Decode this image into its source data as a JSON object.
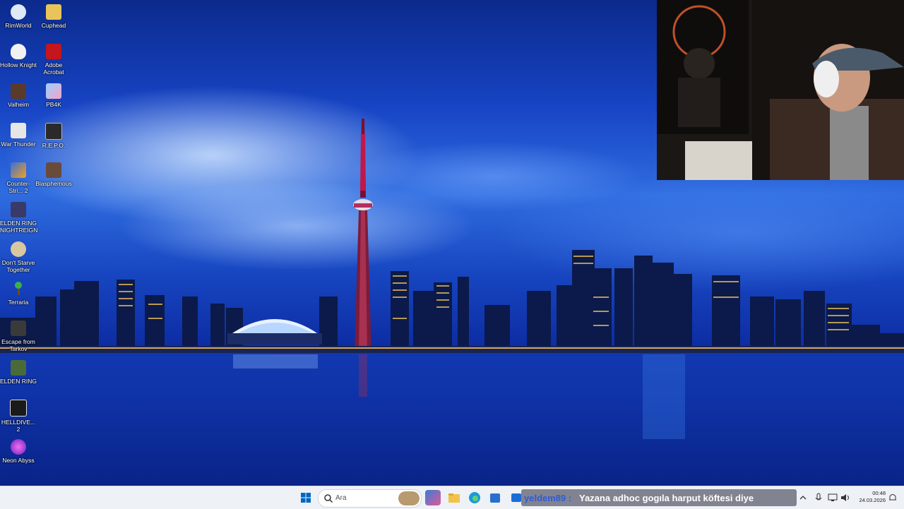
{
  "desktop": {
    "icons": [
      {
        "label": "RimWorld",
        "icon": "rimworld-icon"
      },
      {
        "label": "Cuphead",
        "icon": "cuphead-icon"
      },
      {
        "label": "Hollow Knight",
        "icon": "hollow-knight-icon"
      },
      {
        "label": "Adobe Acrobat",
        "icon": "adobe-acrobat-icon"
      },
      {
        "label": "Valheim",
        "icon": "valheim-icon"
      },
      {
        "label": "PB4K",
        "icon": "pb4k-icon"
      },
      {
        "label": "War Thunder",
        "icon": "war-thunder-icon"
      },
      {
        "label": "R.E.P.O.",
        "icon": "repo-icon"
      },
      {
        "label": "Counter-Stri... 2",
        "icon": "counter-strike-icon"
      },
      {
        "label": "Blasphemous",
        "icon": "blasphemous-icon"
      },
      {
        "label": "ELDEN RING NIGHTREIGN",
        "icon": "elden-ring-nightreign-icon"
      },
      {
        "label": "Don't Starve Together",
        "icon": "dont-starve-icon"
      },
      {
        "label": "Terraria",
        "icon": "terraria-icon"
      },
      {
        "label": "Escape from Tarkov",
        "icon": "tarkov-icon"
      },
      {
        "label": "ELDEN RING",
        "icon": "elden-ring-icon"
      },
      {
        "label": "HELLDIVE... 2",
        "icon": "helldivers-icon"
      },
      {
        "label": "Neon Abyss",
        "icon": "neon-abyss-icon"
      }
    ]
  },
  "taskbar": {
    "search_placeholder": "Ara",
    "chat_user": "yeldem89 :",
    "chat_message": "Yazana adhoc gogıla harput köftesi diye",
    "clock_time": "00:48",
    "clock_date": "24.03.2026"
  },
  "colors": {
    "windows_blue": "#0067c0",
    "chat_name": "#2f5bd9"
  }
}
